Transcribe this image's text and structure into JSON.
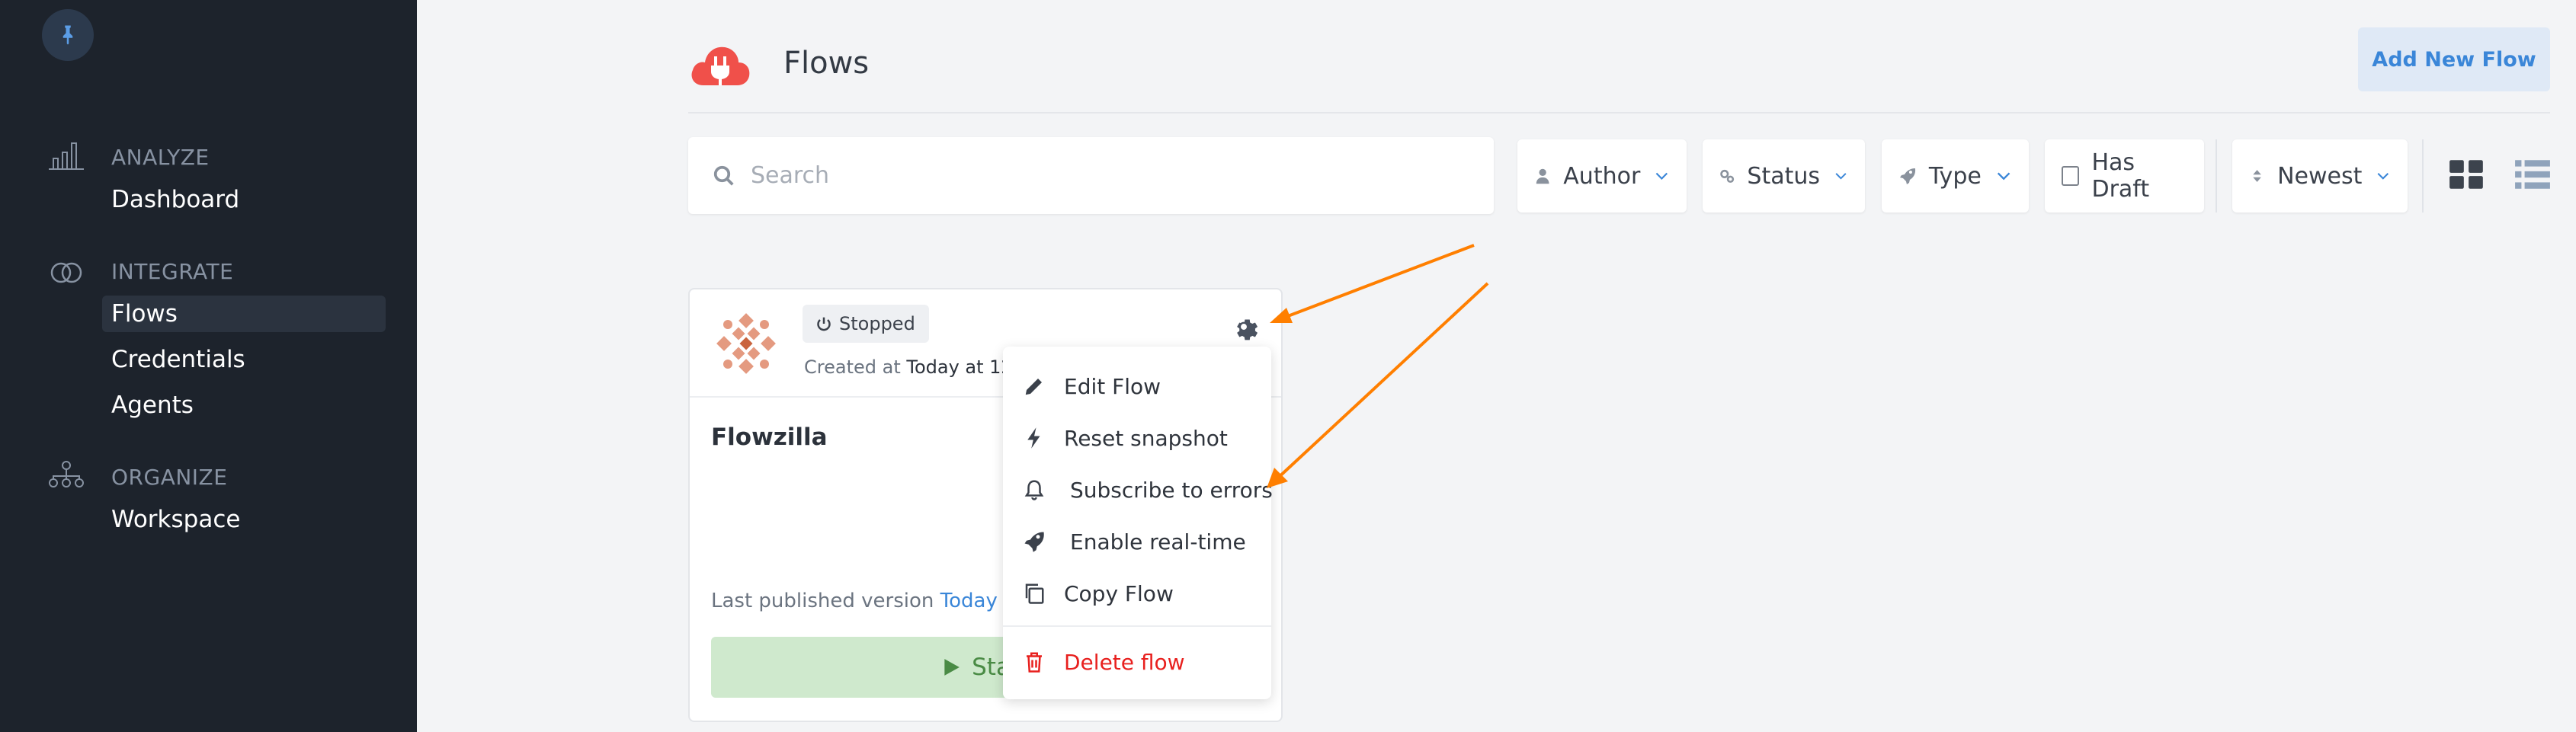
{
  "sidebar": {
    "sections": [
      {
        "heading": "ANALYZE",
        "icon": "bar-chart-icon",
        "items": [
          {
            "label": "Dashboard",
            "active": false
          }
        ]
      },
      {
        "heading": "INTEGRATE",
        "icon": "integrate-rings-icon",
        "items": [
          {
            "label": "Flows",
            "active": true
          },
          {
            "label": "Credentials",
            "active": false
          },
          {
            "label": "Agents",
            "active": false
          }
        ]
      },
      {
        "heading": "ORGANIZE",
        "icon": "org-chart-icon",
        "items": [
          {
            "label": "Workspace",
            "active": false
          }
        ]
      }
    ]
  },
  "header": {
    "title": "Flows",
    "add_button": "Add New Flow",
    "logo_icon": "cloud-plug-icon",
    "logo_color": "#f0504a"
  },
  "filters": {
    "search_placeholder": "Search",
    "author": "Author",
    "status": "Status",
    "type": "Type",
    "has_draft": "Has Draft",
    "sort": "Newest"
  },
  "card": {
    "status": "Stopped",
    "created_label": "Created at",
    "created_value": "Today at 12:3",
    "name": "Flowzilla",
    "published_label": "Last published version",
    "published_value": "Today at",
    "start_label": "Start"
  },
  "menu": {
    "items": [
      {
        "label": "Edit Flow",
        "icon": "pencil-icon"
      },
      {
        "label": "Reset snapshot",
        "icon": "bolt-icon"
      },
      {
        "label": "Subscribe to errors",
        "icon": "bell-icon"
      },
      {
        "label": "Enable real-time",
        "icon": "rocket-icon"
      },
      {
        "label": "Copy Flow",
        "icon": "copy-icon"
      }
    ],
    "danger_item": {
      "label": "Delete flow",
      "icon": "trash-icon"
    }
  },
  "colors": {
    "accent": "#3a86d8",
    "sidebar_bg": "#1d232c",
    "danger": "#e8201e",
    "success_bg": "#cfe9cd",
    "annotation": "#ff7f00"
  }
}
